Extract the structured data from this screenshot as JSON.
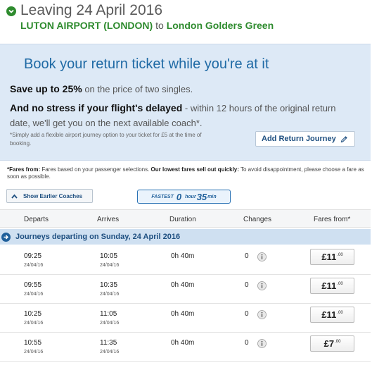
{
  "header": {
    "title": "Leaving 24 April 2016",
    "origin": "LUTON AIRPORT (LONDON)",
    "to": "to",
    "destination": "London Golders Green"
  },
  "promo": {
    "headline": "Book your return ticket while you're at it",
    "save_bold": "Save up to 25%",
    "save_rest": " on the price of two singles.",
    "stress_bold": "And no stress if your flight's delayed",
    "stress_rest": " - within 12 hours of the original return date, we'll get you on the next available coach*.",
    "note": "*Simply add a flexible airport journey option to your ticket for £5 at the time of booking.",
    "add_return_label": "Add Return Journey"
  },
  "fares_note": {
    "bold1": "*Fares from:",
    "text1": " Fares based on your passenger selections. ",
    "bold2": "Our lowest fares sell out quickly:",
    "text2": " To avoid disappointment, please choose a fare as soon as possible."
  },
  "controls": {
    "show_earlier_label": "Show Earlier Coaches",
    "fastest_label": "FASTEST",
    "fastest_hours": "0",
    "fastest_hour_label": "hour",
    "fastest_minutes": "35",
    "fastest_min_label": "min"
  },
  "table": {
    "columns": [
      "Departs",
      "Arrives",
      "Duration",
      "Changes",
      "Fares from*"
    ],
    "day_banner": "Journeys departing on Sunday, 24 April 2016",
    "rows": [
      {
        "depart": "09:25",
        "depart_date": "24/04/16",
        "arrive": "10:05",
        "arrive_date": "24/04/16",
        "duration": "0h 40m",
        "changes": "0",
        "fare": "£11",
        "fare_pence": ".00"
      },
      {
        "depart": "09:55",
        "depart_date": "24/04/16",
        "arrive": "10:35",
        "arrive_date": "24/04/16",
        "duration": "0h 40m",
        "changes": "0",
        "fare": "£11",
        "fare_pence": ".00"
      },
      {
        "depart": "10:25",
        "depart_date": "24/04/16",
        "arrive": "11:05",
        "arrive_date": "24/04/16",
        "duration": "0h 40m",
        "changes": "0",
        "fare": "£11",
        "fare_pence": ".00"
      },
      {
        "depart": "10:55",
        "depart_date": "24/04/16",
        "arrive": "11:35",
        "arrive_date": "24/04/16",
        "duration": "0h 40m",
        "changes": "0",
        "fare": "£7",
        "fare_pence": ".00"
      }
    ]
  },
  "colors": {
    "brand_green": "#2e8b2e",
    "link_blue": "#1f6aa5",
    "promo_bg": "#dde9f6",
    "banner_bg": "#cfe0f1"
  },
  "icons": {
    "header_chevron": "chevron-circle-icon",
    "edit": "pencil-icon",
    "show_earlier": "chevron-up-icon",
    "banner": "arrow-circle-right-icon",
    "info": "info-icon"
  }
}
